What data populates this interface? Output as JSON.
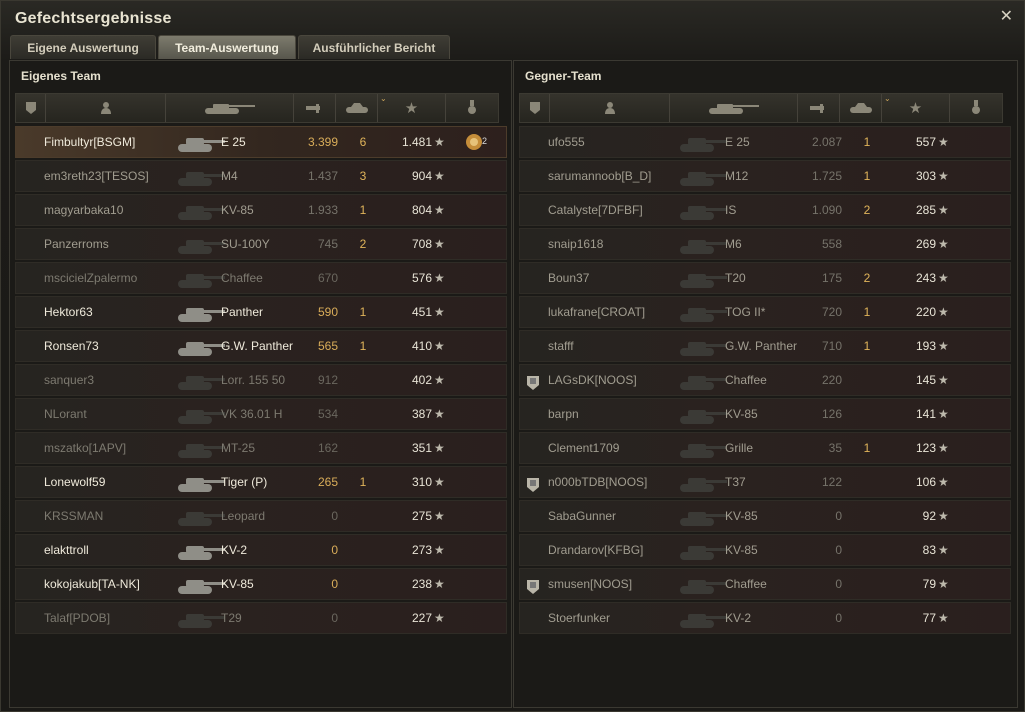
{
  "window": {
    "title": "Gefechtsergebnisse",
    "close_label": "✕"
  },
  "tabs": [
    {
      "label": "Eigene Auswertung",
      "active": false
    },
    {
      "label": "Team-Auswertung",
      "active": true
    },
    {
      "label": "Ausführlicher Bericht",
      "active": false
    }
  ],
  "left": {
    "title": "Eigenes Team",
    "rows": [
      {
        "player": "Fimbultyr[BSGM]",
        "tank": "E 25",
        "dmg": "3.399",
        "kills": "6",
        "xp": "1.481",
        "style": "hl",
        "medal": true
      },
      {
        "player": "em3reth23[TESOS]",
        "tank": "M4",
        "dmg": "1.437",
        "kills": "3",
        "xp": "904",
        "style": "mid"
      },
      {
        "player": "magyarbaka10",
        "tank": "KV-85",
        "dmg": "1.933",
        "kills": "1",
        "xp": "804",
        "style": "mid"
      },
      {
        "player": "Panzerroms",
        "tank": "SU-100Y",
        "dmg": "745",
        "kills": "2",
        "xp": "708",
        "style": "mid"
      },
      {
        "player": "mscicielZpalermo",
        "tank": "Chaffee",
        "dmg": "670",
        "kills": "",
        "xp": "576",
        "style": "dim"
      },
      {
        "player": "Hektor63",
        "tank": "Panther",
        "dmg": "590",
        "kills": "1",
        "xp": "451",
        "style": "bright"
      },
      {
        "player": "Ronsen73",
        "tank": "G.W. Panther",
        "dmg": "565",
        "kills": "1",
        "xp": "410",
        "style": "bright"
      },
      {
        "player": "sanquer3",
        "tank": "Lorr. 155 50",
        "dmg": "912",
        "kills": "",
        "xp": "402",
        "style": "dim"
      },
      {
        "player": "NLorant",
        "tank": "VK 36.01 H",
        "dmg": "534",
        "kills": "",
        "xp": "387",
        "style": "dim"
      },
      {
        "player": "mszatko[1APV]",
        "tank": "MT-25",
        "dmg": "162",
        "kills": "",
        "xp": "351",
        "style": "dim"
      },
      {
        "player": "Lonewolf59",
        "tank": "Tiger (P)",
        "dmg": "265",
        "kills": "1",
        "xp": "310",
        "style": "bright"
      },
      {
        "player": "KRSSMAN",
        "tank": "Leopard",
        "dmg": "0",
        "kills": "",
        "xp": "275",
        "style": "dim"
      },
      {
        "player": "elakttroll",
        "tank": "KV-2",
        "dmg": "0",
        "kills": "",
        "xp": "273",
        "style": "bright"
      },
      {
        "player": "kokojakub[TA-NK]",
        "tank": "KV-85",
        "dmg": "0",
        "kills": "",
        "xp": "238",
        "style": "bright"
      },
      {
        "player": "Talaf[PDOB]",
        "tank": "T29",
        "dmg": "0",
        "kills": "",
        "xp": "227",
        "style": "dim"
      }
    ]
  },
  "right": {
    "title": "Gegner-Team",
    "rows": [
      {
        "player": "ufo555",
        "tank": "E 25",
        "dmg": "2.087",
        "kills": "1",
        "xp": "557",
        "badge": false
      },
      {
        "player": "sarumannoob[B_D]",
        "tank": "M12",
        "dmg": "1.725",
        "kills": "1",
        "xp": "303",
        "badge": false
      },
      {
        "player": "Catalyste[7DFBF]",
        "tank": "IS",
        "dmg": "1.090",
        "kills": "2",
        "xp": "285",
        "badge": false
      },
      {
        "player": "snaip1618",
        "tank": "M6",
        "dmg": "558",
        "kills": "",
        "xp": "269",
        "badge": false
      },
      {
        "player": "Boun37",
        "tank": "T20",
        "dmg": "175",
        "kills": "2",
        "xp": "243",
        "badge": false
      },
      {
        "player": "lukafrane[CROAT]",
        "tank": "TOG II*",
        "dmg": "720",
        "kills": "1",
        "xp": "220",
        "badge": false
      },
      {
        "player": "stafff",
        "tank": "G.W. Panther",
        "dmg": "710",
        "kills": "1",
        "xp": "193",
        "badge": false
      },
      {
        "player": "LAGsDK[NOOS]",
        "tank": "Chaffee",
        "dmg": "220",
        "kills": "",
        "xp": "145",
        "badge": true
      },
      {
        "player": "barpn",
        "tank": "KV-85",
        "dmg": "126",
        "kills": "",
        "xp": "141",
        "badge": false
      },
      {
        "player": "Clement1709",
        "tank": "Grille",
        "dmg": "35",
        "kills": "1",
        "xp": "123",
        "badge": false
      },
      {
        "player": "n000bTDB[NOOS]",
        "tank": "T37",
        "dmg": "122",
        "kills": "",
        "xp": "106",
        "badge": true
      },
      {
        "player": "SabaGunner",
        "tank": "KV-85",
        "dmg": "0",
        "kills": "",
        "xp": "92",
        "badge": false
      },
      {
        "player": "Drandarov[KFBG]",
        "tank": "KV-85",
        "dmg": "0",
        "kills": "",
        "xp": "83",
        "badge": false
      },
      {
        "player": "smusen[NOOS]",
        "tank": "Chaffee",
        "dmg": "0",
        "kills": "",
        "xp": "79",
        "badge": true
      },
      {
        "player": "Stoerfunker",
        "tank": "KV-2",
        "dmg": "0",
        "kills": "",
        "xp": "77",
        "badge": false
      }
    ]
  },
  "medal": {
    "count": "2"
  },
  "colors": {
    "accent": "#e0b45a",
    "kills": "#e0b45a",
    "row_highlight": "#4a3a2a"
  },
  "icons": {
    "header": [
      "badge-icon",
      "player-icon",
      "tank-icon",
      "damage-icon",
      "kills-icon",
      "xp-star-icon",
      "medal-icon"
    ],
    "star": "★"
  }
}
